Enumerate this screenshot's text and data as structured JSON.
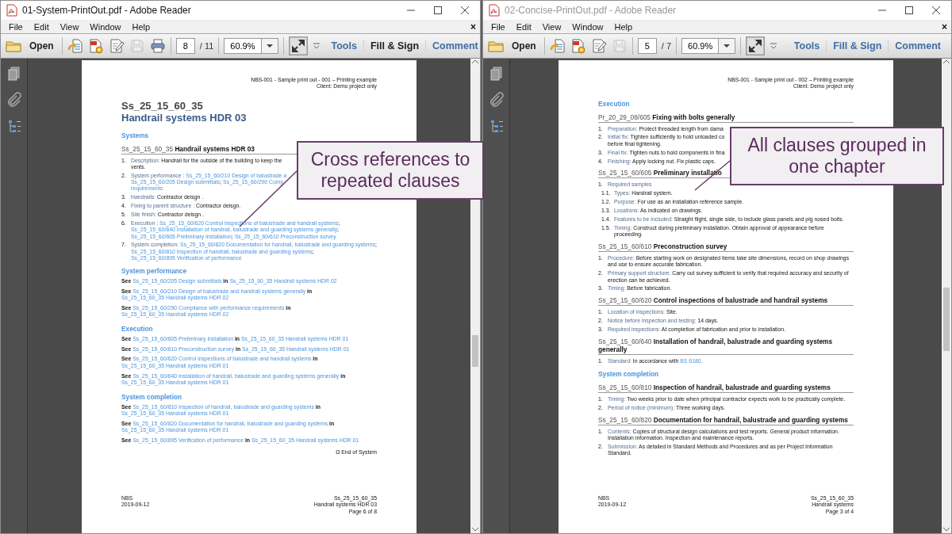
{
  "windows": [
    {
      "title": "01-System-PrintOut.pdf - Adobe Reader",
      "active": true,
      "menu": [
        "File",
        "Edit",
        "View",
        "Window",
        "Help"
      ],
      "menu_close": "×",
      "toolbar": {
        "open": "Open",
        "icons": [
          {
            "kind": "export",
            "disabled": false
          },
          {
            "kind": "convert",
            "disabled": false
          },
          {
            "kind": "edit",
            "disabled": false
          },
          {
            "kind": "save",
            "disabled": true
          },
          {
            "kind": "print",
            "disabled": false
          }
        ],
        "page": "8",
        "pages": "/ 11",
        "zoom": "60.9%",
        "tabs": [
          {
            "label": "Tools",
            "selected": false
          },
          {
            "label": "Fill & Sign",
            "selected": true
          },
          {
            "label": "Comment",
            "selected": false
          }
        ]
      },
      "page": {
        "blocks": [
          {
            "kind": "header",
            "lines": [
              "NBS-001 - Sample print out - 001 – Printing example",
              "Client: Demo project only"
            ]
          },
          {
            "kind": "title",
            "code": "Ss_25_15_60_35",
            "name": "Handrail systems HDR 03"
          },
          {
            "kind": "section",
            "text": "Systems"
          },
          {
            "kind": "clause",
            "text": "Ss_25_15_60_35 **Handrail systems HDR 03**"
          },
          {
            "kind": "item",
            "num": "1.",
            "parts": [
              {
                "kind": "label",
                "text": "Description:"
              },
              {
                "kind": "text",
                "text": " Handrail for the outside of the building to keep the\nvents."
              }
            ]
          },
          {
            "kind": "item",
            "num": "2.",
            "parts": [
              {
                "kind": "label",
                "text": "System performance : "
              },
              {
                "kind": "link",
                "text": "Ss_25_15_60/210 Design of balustrade a"
              },
              {
                "kind": "break"
              },
              {
                "kind": "link",
                "text": "Ss_25_15_60/205 Design submittals"
              },
              {
                "kind": "text",
                "text": "; "
              },
              {
                "kind": "link",
                "text": "Ss_25_15_60/290 Comp"
              },
              {
                "kind": "break"
              },
              {
                "kind": "link",
                "text": "requirements"
              }
            ]
          },
          {
            "kind": "item",
            "num": "3.",
            "parts": [
              {
                "kind": "label",
                "text": "Handrails:"
              },
              {
                "kind": "text",
                "text": " Contractor deisgn ."
              }
            ]
          },
          {
            "kind": "item",
            "num": "4.",
            "parts": [
              {
                "kind": "label",
                "text": "Fixing to parent structure :"
              },
              {
                "kind": "text",
                "text": " Contractor deisgn."
              }
            ]
          },
          {
            "kind": "item",
            "num": "5.",
            "parts": [
              {
                "kind": "label",
                "text": "Site finish:"
              },
              {
                "kind": "text",
                "text": " Contractor deisgn ."
              }
            ]
          },
          {
            "kind": "item",
            "num": "6.",
            "parts": [
              {
                "kind": "label",
                "text": "Execution : "
              },
              {
                "kind": "link",
                "text": "Ss_25_15_60/620 Control inspections of balustrade and handrail systems"
              },
              {
                "kind": "text",
                "text": "; "
              },
              {
                "kind": "link",
                "text": "Ss_25_15_60/640 Installation of handrail, balustrade and guarding systems generally"
              },
              {
                "kind": "text",
                "text": "; "
              },
              {
                "kind": "link",
                "text": "Ss_25_15_60/605 Preliminary installation"
              },
              {
                "kind": "text",
                "text": "; "
              },
              {
                "kind": "link",
                "text": "Ss_25_15_60/610 Preconstruction survey"
              }
            ]
          },
          {
            "kind": "item",
            "num": "7.",
            "parts": [
              {
                "kind": "label",
                "text": "System completion: "
              },
              {
                "kind": "link",
                "text": "Ss_25_15_60/820 Documentation for handrail, balustrade and guarding systems"
              },
              {
                "kind": "text",
                "text": "; "
              },
              {
                "kind": "link",
                "text": "Ss_25_15_60/810 Inspection of handrail, balustrade and guarding systems"
              },
              {
                "kind": "text",
                "text": "; "
              },
              {
                "kind": "link",
                "text": "Ss_25_15_60/895 Verification of performance"
              }
            ]
          },
          {
            "kind": "section",
            "text": "System performance"
          },
          {
            "kind": "para",
            "parts": [
              {
                "kind": "strong",
                "text": "See "
              },
              {
                "kind": "link",
                "text": "Ss_25_15_60/205 Design submittals"
              },
              {
                "kind": "strong",
                "text": " in "
              },
              {
                "kind": "link",
                "text": "Ss_25_15_60_35 Handrail systems HDR 02"
              }
            ]
          },
          {
            "kind": "para",
            "parts": [
              {
                "kind": "strong",
                "text": "See "
              },
              {
                "kind": "link",
                "text": "Ss_25_15_60/210 Design of balustrade and handrail systems generally"
              },
              {
                "kind": "strong",
                "text": " in "
              },
              {
                "kind": "link",
                "text": "Ss_25_15_60_35 Handrail systems HDR 02"
              }
            ]
          },
          {
            "kind": "para",
            "parts": [
              {
                "kind": "strong",
                "text": "See "
              },
              {
                "kind": "link",
                "text": "Ss_25_15_60/290 Compliance with performance requirements"
              },
              {
                "kind": "strong",
                "text": " in "
              },
              {
                "kind": "link",
                "text": "Ss_25_15_60_35 Handrail systems HDR 02"
              }
            ]
          },
          {
            "kind": "section",
            "text": "Execution"
          },
          {
            "kind": "para",
            "parts": [
              {
                "kind": "strong",
                "text": "See "
              },
              {
                "kind": "link",
                "text": "Ss_25_15_60/605 Preliminary installation"
              },
              {
                "kind": "strong",
                "text": " in "
              },
              {
                "kind": "link",
                "text": "Ss_25_15_60_35 Handrail systems HDR 01"
              }
            ]
          },
          {
            "kind": "para",
            "parts": [
              {
                "kind": "strong",
                "text": "See "
              },
              {
                "kind": "link",
                "text": "Ss_25_15_60/610 Preconstruction survey"
              },
              {
                "kind": "strong",
                "text": " in "
              },
              {
                "kind": "link",
                "text": "Ss_25_15_60_35 Handrail systems HDR 01"
              }
            ]
          },
          {
            "kind": "para",
            "parts": [
              {
                "kind": "strong",
                "text": "See "
              },
              {
                "kind": "link",
                "text": "Ss_25_15_60/620 Control inspections of balustrade and handrail systems"
              },
              {
                "kind": "strong",
                "text": " in "
              },
              {
                "kind": "link",
                "text": "Ss_25_15_60_35 Handrail systems HDR 01"
              }
            ]
          },
          {
            "kind": "para",
            "parts": [
              {
                "kind": "strong",
                "text": "See "
              },
              {
                "kind": "link",
                "text": "Ss_25_15_60/640 Installation of handrail, balustrade and guarding systems generally"
              },
              {
                "kind": "strong",
                "text": " in "
              },
              {
                "kind": "link",
                "text": "Ss_25_15_60_35 Handrail systems HDR 01"
              }
            ]
          },
          {
            "kind": "section",
            "text": "System completion"
          },
          {
            "kind": "para",
            "parts": [
              {
                "kind": "strong",
                "text": "See "
              },
              {
                "kind": "link",
                "text": "Ss_25_15_60/810 Inspection of handrail, balustrade and guarding systems"
              },
              {
                "kind": "strong",
                "text": " in "
              },
              {
                "kind": "link",
                "text": "Ss_25_15_60_35 Handrail systems HDR 01"
              }
            ]
          },
          {
            "kind": "para",
            "parts": [
              {
                "kind": "strong",
                "text": "See "
              },
              {
                "kind": "link",
                "text": "Ss_25_15_60/820 Documentation for handrail, balustrade and guarding systems"
              },
              {
                "kind": "strong",
                "text": " in "
              },
              {
                "kind": "link",
                "text": "Ss_25_15_60_35 Handrail systems HDR 01"
              }
            ]
          },
          {
            "kind": "para",
            "parts": [
              {
                "kind": "strong",
                "text": "See "
              },
              {
                "kind": "link",
                "text": "Ss_25_15_60/895 Verification of performance"
              },
              {
                "kind": "strong",
                "text": " in "
              },
              {
                "kind": "link",
                "text": "Ss_25_15_60_35 Handrail systems HDR 01"
              }
            ]
          },
          {
            "kind": "end",
            "text": "Ω End of System"
          }
        ],
        "footer": {
          "left": [
            "NBS",
            "2019-09-12"
          ],
          "right": [
            "Ss_25_15_60_35",
            "Handrail systems HDR 03",
            "Page 6 of 8"
          ]
        }
      }
    },
    {
      "title": "02-Concise-PrintOut.pdf - Adobe Reader",
      "active": false,
      "menu": [
        "File",
        "Edit",
        "View",
        "Window",
        "Help"
      ],
      "menu_close": "×",
      "toolbar": {
        "open": "Open",
        "icons": [
          {
            "kind": "export",
            "disabled": false
          },
          {
            "kind": "convert",
            "disabled": false
          },
          {
            "kind": "edit",
            "disabled": false
          },
          {
            "kind": "save",
            "disabled": true
          }
        ],
        "page": "5",
        "pages": "/ 7",
        "zoom": "60.9%",
        "tabs": [
          {
            "label": "Tools",
            "selected": false
          },
          {
            "label": "Fill & Sign",
            "selected": false
          },
          {
            "label": "Comment",
            "selected": false
          }
        ]
      },
      "page": {
        "blocks": [
          {
            "kind": "header",
            "lines": [
              "NBS-001 - Sample print out - 002 – Printing example",
              "Client: Demo project only"
            ]
          },
          {
            "kind": "section",
            "text": "Execution"
          },
          {
            "kind": "clause",
            "text": "Pr_20_29_08/605 **Fixing with bolts generally**"
          },
          {
            "kind": "item",
            "num": "1.",
            "parts": [
              {
                "kind": "label",
                "text": "Preparation:"
              },
              {
                "kind": "text",
                "text": " Protect threaded length from dama"
              }
            ]
          },
          {
            "kind": "item",
            "num": "2.",
            "parts": [
              {
                "kind": "label",
                "text": "Initial fix:"
              },
              {
                "kind": "text",
                "text": " Tighten sufficiently to hold unloaded co\nbefore final tightening."
              }
            ]
          },
          {
            "kind": "item",
            "num": "3.",
            "parts": [
              {
                "kind": "label",
                "text": "Final fix:"
              },
              {
                "kind": "text",
                "text": " Tighten nuts to hold components in fina"
              }
            ]
          },
          {
            "kind": "item",
            "num": "4.",
            "parts": [
              {
                "kind": "label",
                "text": "Finishing:"
              },
              {
                "kind": "text",
                "text": " Apply locking nut. Fix plastic caps."
              }
            ]
          },
          {
            "kind": "clause",
            "text": "Ss_25_15_60/605 **Preliminary installatio**"
          },
          {
            "kind": "item",
            "num": "1.",
            "parts": [
              {
                "kind": "label",
                "text": "Required samples"
              }
            ]
          },
          {
            "kind": "subitem",
            "num": "1.1.",
            "parts": [
              {
                "kind": "label",
                "text": "Types:"
              },
              {
                "kind": "text",
                "text": " Handrail system."
              }
            ]
          },
          {
            "kind": "subitem",
            "num": "1.2.",
            "parts": [
              {
                "kind": "label",
                "text": "Purpose:"
              },
              {
                "kind": "text",
                "text": " For use as an installation reference sample."
              }
            ]
          },
          {
            "kind": "subitem",
            "num": "1.3.",
            "parts": [
              {
                "kind": "label",
                "text": "Locations:"
              },
              {
                "kind": "text",
                "text": " As indicated on drawings."
              }
            ]
          },
          {
            "kind": "subitem",
            "num": "1.4.",
            "parts": [
              {
                "kind": "label",
                "text": "Features to be included:"
              },
              {
                "kind": "text",
                "text": " Straight flight, single side, to include glass panels and pig nosed bolts."
              }
            ]
          },
          {
            "kind": "subitem",
            "num": "1.5.",
            "parts": [
              {
                "kind": "label",
                "text": "Timing:"
              },
              {
                "kind": "text",
                "text": " Construct during preliminary installation. Obtain approval of appearance before proceeding."
              }
            ]
          },
          {
            "kind": "clause",
            "text": "Ss_25_15_60/610 **Preconstruction survey**"
          },
          {
            "kind": "item",
            "num": "1.",
            "parts": [
              {
                "kind": "label",
                "text": "Procedure:"
              },
              {
                "kind": "text",
                "text": " Before starting work on designated items take site dimensions, record on shop drawings and use to ensure accurate fabrication."
              }
            ]
          },
          {
            "kind": "item",
            "num": "2.",
            "parts": [
              {
                "kind": "label",
                "text": "Primary support structure:"
              },
              {
                "kind": "text",
                "text": " Carry out survey sufficient to verify that required accuracy and security of erection can be achieved."
              }
            ]
          },
          {
            "kind": "item",
            "num": "3.",
            "parts": [
              {
                "kind": "label",
                "text": "Timing:"
              },
              {
                "kind": "text",
                "text": " Before fabrication."
              }
            ]
          },
          {
            "kind": "clause",
            "text": "Ss_25_15_60/620 **Control inspections of balustrade and handrail systems**"
          },
          {
            "kind": "item",
            "num": "1.",
            "parts": [
              {
                "kind": "label",
                "text": "Location of inspections:"
              },
              {
                "kind": "text",
                "text": " Site."
              }
            ]
          },
          {
            "kind": "item",
            "num": "2.",
            "parts": [
              {
                "kind": "label",
                "text": "Notice before inspection and testing:"
              },
              {
                "kind": "text",
                "text": " 14 days."
              }
            ]
          },
          {
            "kind": "item",
            "num": "3.",
            "parts": [
              {
                "kind": "label",
                "text": "Required inspections:"
              },
              {
                "kind": "text",
                "text": " At completion of fabrication and prior to installation."
              }
            ]
          },
          {
            "kind": "clause",
            "text": "Ss_25_15_60/640 **Installation of handrail, balustrade and guarding systems generally**"
          },
          {
            "kind": "item",
            "num": "1.",
            "parts": [
              {
                "kind": "label",
                "text": "Standard:"
              },
              {
                "kind": "text",
                "text": " In accordance with "
              },
              {
                "kind": "link",
                "text": "BS 6180"
              },
              {
                "kind": "text",
                "text": "."
              }
            ]
          },
          {
            "kind": "section",
            "text": "System completion"
          },
          {
            "kind": "clause",
            "text": "Ss_25_15_60/810 **Inspection of handrail, balustrade and guarding systems**"
          },
          {
            "kind": "item",
            "num": "1.",
            "parts": [
              {
                "kind": "label",
                "text": "Timing:"
              },
              {
                "kind": "text",
                "text": " Two weeks prior to date when principal contractor expects work to be practically complete."
              }
            ]
          },
          {
            "kind": "item",
            "num": "2.",
            "parts": [
              {
                "kind": "label",
                "text": "Period of notice (minimum):"
              },
              {
                "kind": "text",
                "text": " Three working days."
              }
            ]
          },
          {
            "kind": "clause",
            "text": "Ss_25_15_60/820 **Documentation for handrail, balustrade and guarding systems**"
          },
          {
            "kind": "item",
            "num": "1.",
            "parts": [
              {
                "kind": "label",
                "text": "Contents:"
              },
              {
                "kind": "text",
                "text": " Copies of structural design calculations and test reports. General product information. Installation information. Inspection and maintenance reports."
              }
            ]
          },
          {
            "kind": "item",
            "num": "2.",
            "parts": [
              {
                "kind": "label",
                "text": "Submission:"
              },
              {
                "kind": "text",
                "text": " As detailed in Standard Methods and Procedures and as per Project Information Standard."
              }
            ]
          }
        ],
        "footer": {
          "left": [
            "NBS",
            "2019-09-12"
          ],
          "right": [
            "Ss_25_15_60_35",
            "Handrail systems",
            "Page 3 of 4"
          ]
        }
      }
    }
  ],
  "callouts": [
    {
      "text": "Cross references to repeated clauses"
    },
    {
      "text": "All clauses grouped in one chapter"
    }
  ]
}
